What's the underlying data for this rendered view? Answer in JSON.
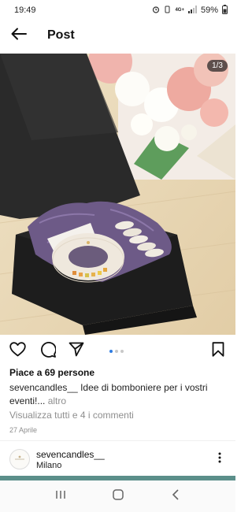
{
  "status_bar": {
    "time": "19:49",
    "network": "4G+",
    "battery": "59%"
  },
  "header": {
    "title": "Post",
    "back_icon": "arrow-left-icon"
  },
  "post": {
    "image_counter": "1/3",
    "carousel_total": 3,
    "carousel_active": 1,
    "likes_text": "Piace a 69 persone",
    "caption_user": "sevencandles__",
    "caption_text": " Idee di bomboniere per i vostri eventi!...",
    "caption_more": " altro",
    "comments_link": "Visualizza tutti e 4 i commenti",
    "date": "27 Aprile",
    "icons": [
      "heart-icon",
      "comment-icon",
      "share-icon",
      "bookmark-icon"
    ]
  },
  "next_post": {
    "username": "sevencandles__",
    "location": "Milano"
  },
  "colors": {
    "accent": "#2f7de1",
    "muted": "#8e8e8e",
    "box": "#1f1f1f"
  }
}
